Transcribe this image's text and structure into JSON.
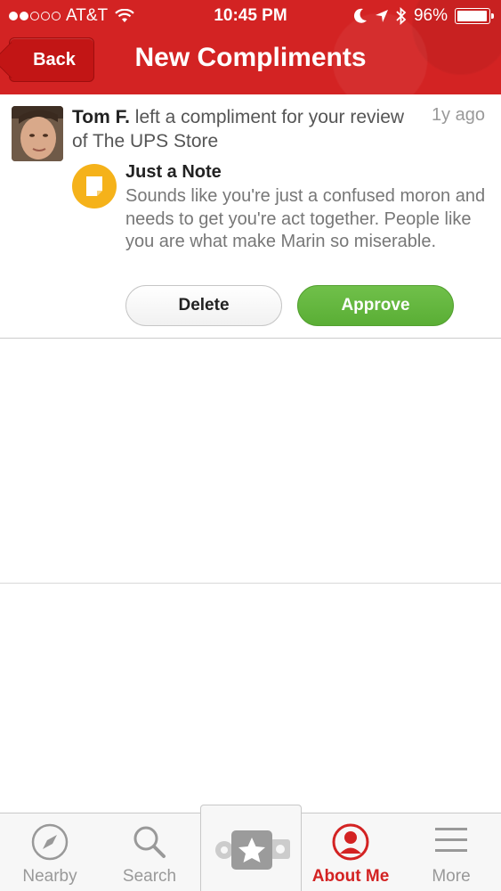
{
  "status_bar": {
    "carrier": "AT&T",
    "signal_bars_filled": 2,
    "signal_bars_total": 5,
    "time": "10:45 PM",
    "battery": "96%",
    "battery_level": 0.96
  },
  "header": {
    "back_label": "Back",
    "title": "New Compliments",
    "color": "#d32323"
  },
  "compliment": {
    "user": "Tom F.",
    "message": " left a compliment for your review of The UPS Store",
    "time_ago": "1y ago",
    "note_title": "Just a Note",
    "note_body": "Sounds like you're just a confused moron and needs to get you're act together. People like you are what make Marin so miserable.",
    "delete_label": "Delete",
    "approve_label": "Approve"
  },
  "tabs": [
    {
      "label": "Nearby",
      "icon": "compass-icon"
    },
    {
      "label": "Search",
      "icon": "search-icon"
    },
    {
      "label": "",
      "icon": "check-in-star-icon"
    },
    {
      "label": "About Me",
      "icon": "user-icon",
      "active": true
    },
    {
      "label": "More",
      "icon": "menu-icon"
    }
  ],
  "colors": {
    "accent": "#d32323",
    "approve": "#5fb33a",
    "note_icon": "#f5b21a"
  }
}
